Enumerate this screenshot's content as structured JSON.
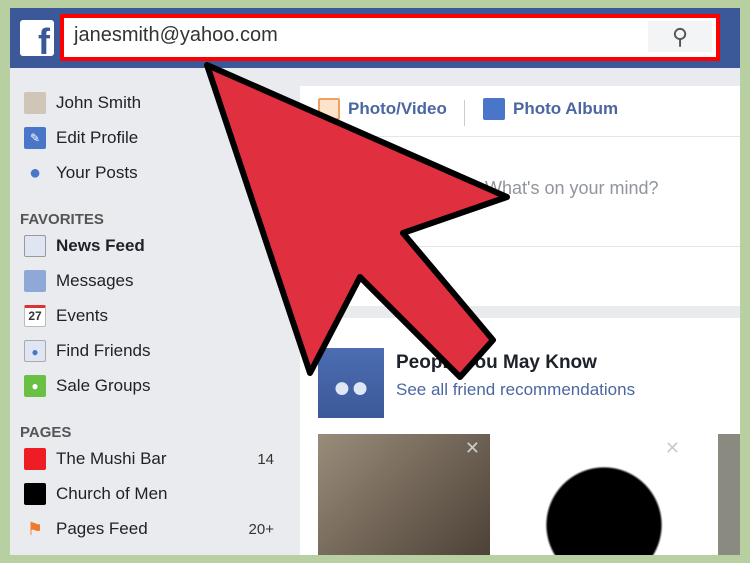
{
  "header": {
    "logo": "f",
    "search_value": "janesmith@yahoo.com",
    "search_icon": "search-icon"
  },
  "sidebar": {
    "profile": [
      {
        "label": "John Smith",
        "icon": "avatar"
      },
      {
        "label": "Edit Profile",
        "icon": "pencil-icon"
      },
      {
        "label": "Your Posts",
        "icon": "person-icon"
      }
    ],
    "favorites_title": "FAVORITES",
    "favorites": [
      {
        "label": "News Feed",
        "icon": "news-feed-icon"
      },
      {
        "label": "Messages",
        "icon": "messages-icon"
      },
      {
        "label": "Events",
        "icon": "calendar-icon",
        "icon_text": "27"
      },
      {
        "label": "Find Friends",
        "icon": "friends-icon"
      },
      {
        "label": "Sale Groups",
        "icon": "tag-icon"
      }
    ],
    "pages_title": "PAGES",
    "pages": [
      {
        "label": "The Mushi Bar",
        "count": "14",
        "color": "#ee1c25"
      },
      {
        "label": "Church of Men",
        "count": "",
        "color": "#000000"
      },
      {
        "label": "Pages Feed",
        "count": "20+",
        "icon": "flag-icon"
      }
    ]
  },
  "composer": {
    "tabs": [
      {
        "label": "Photo/Video"
      },
      {
        "label": "Photo Album"
      }
    ],
    "placeholder": "What's on your mind?"
  },
  "pymk": {
    "title": "People You May Know",
    "link": "See all friend recommendations"
  },
  "colors": {
    "brand": "#3b5998",
    "highlight": "#ff0000",
    "arrow": "#e0303f",
    "frame": "#b8cfa1"
  }
}
